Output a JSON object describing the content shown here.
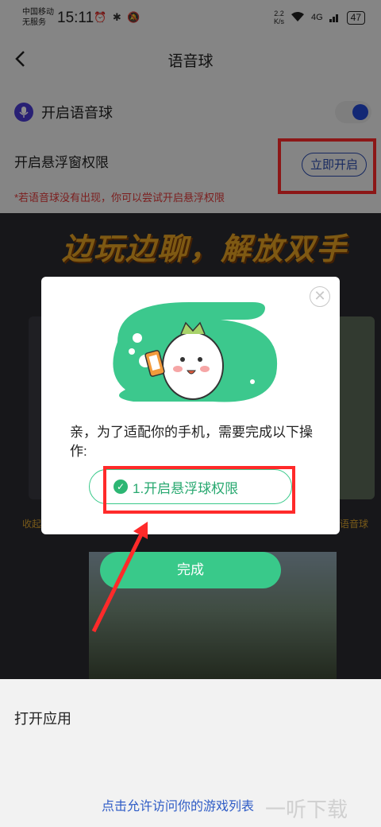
{
  "status_bar": {
    "carrier_line1": "中国移动",
    "carrier_line2": "无服务",
    "time": "15:11",
    "net_speed_value": "2.2",
    "net_speed_unit": "K/s",
    "signal_label": "4G",
    "battery": "47"
  },
  "header": {
    "title": "语音球"
  },
  "settings": {
    "voice_ball_label": "开启语音球",
    "voice_ball_enabled": true,
    "float_permission_label": "开启悬浮窗权限",
    "open_now_button": "立即开启",
    "hint": "*若语音球没有出现，你可以尝试开启悬浮权限",
    "open_app_label": "打开应用",
    "allow_games_link": "点击允许访问你的游戏列表"
  },
  "banner": {
    "slogan": "边玩边聊，解放双手",
    "left_label": "收起",
    "right_label": "语音球"
  },
  "dialog": {
    "message": "亲，为了适配你的手机，需要完成以下操作:",
    "step_button": "1.开启悬浮球权限",
    "done_button": "完成"
  },
  "watermark": "一听下载",
  "colors": {
    "accent_green": "#39c98a",
    "accent_blue": "#2449d6",
    "highlight_red": "#ff2a2a",
    "hint_red": "#e23a3a"
  }
}
